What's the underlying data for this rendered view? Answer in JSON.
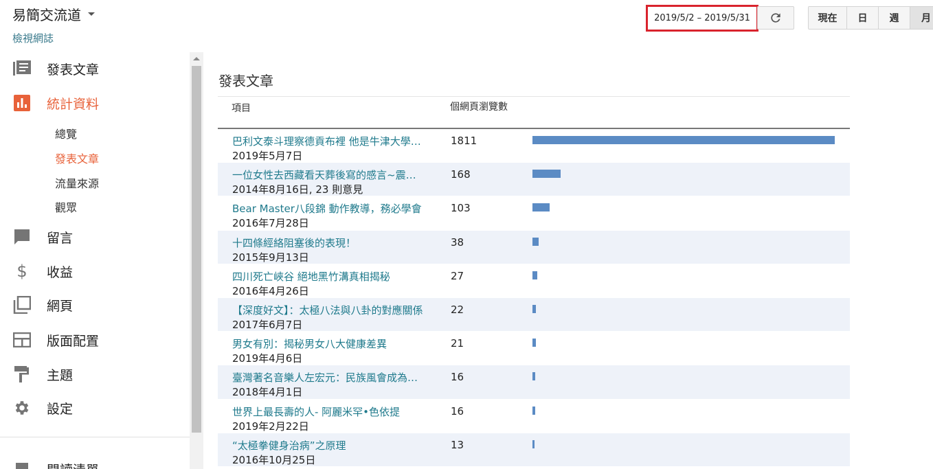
{
  "header": {
    "blog_title": "易簡交流道",
    "view_blog": "檢視網誌",
    "date_range": "2019/5/2 – 2019/5/31",
    "periods": [
      "現在",
      "日",
      "週",
      "月"
    ],
    "selected_period": "月"
  },
  "sidebar": {
    "items": [
      {
        "label": "發表文章",
        "icon": "posts-icon"
      },
      {
        "label": "統計資料",
        "icon": "stats-icon",
        "active": true
      },
      {
        "label": "留言",
        "icon": "comments-icon"
      },
      {
        "label": "收益",
        "icon": "earnings-icon"
      },
      {
        "label": "網頁",
        "icon": "pages-icon"
      },
      {
        "label": "版面配置",
        "icon": "layout-icon"
      },
      {
        "label": "主題",
        "icon": "theme-icon"
      },
      {
        "label": "設定",
        "icon": "settings-icon"
      }
    ],
    "stats_sub": [
      {
        "label": "總覽"
      },
      {
        "label": "發表文章",
        "active": true
      },
      {
        "label": "流量來源"
      },
      {
        "label": "觀眾"
      }
    ],
    "partial_item": "閱讀清單",
    "colors": {
      "active": "#e8623a"
    }
  },
  "main": {
    "section_title": "發表文章",
    "col_item": "項目",
    "col_views": "個網頁瀏覽數",
    "max_views": 1811,
    "bar_color": "#5b8bc4",
    "rows": [
      {
        "title": "巴利文泰斗理察德貢布裡 他是牛津大學的教授",
        "sub": "2019年5月7日",
        "views": 1811
      },
      {
        "title": "一位女性去西藏看天葬後寫的感言~震撼心靈",
        "sub": "2014年8月16日, 23 則意見",
        "views": 168
      },
      {
        "title": "Bear Master八段錦 動作教導，務必學會",
        "sub": "2016年7月28日",
        "views": 103
      },
      {
        "title": "十四條經絡阻塞後的表現！",
        "sub": "2015年9月13日",
        "views": 38
      },
      {
        "title": "四川死亡峽谷 絕地黑竹溝真相揭秘",
        "sub": "2016年4月26日",
        "views": 27
      },
      {
        "title": "【深度好文】：太極八法與八卦的對應關係",
        "sub": "2017年6月7日",
        "views": 22
      },
      {
        "title": "男女有別：揭秘男女八大健康差異",
        "sub": "2019年4月6日",
        "views": 21
      },
      {
        "title": "臺灣著名音樂人左宏元：民族風會成為主流",
        "sub": "2018年4月1日",
        "views": 16
      },
      {
        "title": "世界上最長壽的人- 阿麗米罕•色依提",
        "sub": "2019年2月22日",
        "views": 16
      },
      {
        "title": "“太極拳健身治病”之原理",
        "sub": "2016年10月25日",
        "views": 13
      }
    ]
  }
}
